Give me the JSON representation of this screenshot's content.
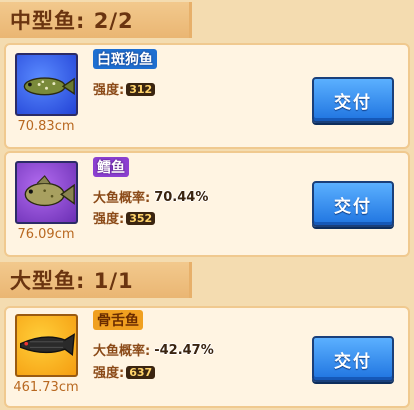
{
  "sections": [
    {
      "title": "中型鱼: 2/2"
    },
    {
      "title": "大型鱼: 1/1"
    }
  ],
  "cards": [
    {
      "name": "白斑狗鱼",
      "size": "70.83cm",
      "strength_label": "强度:",
      "strength": "312",
      "button": "交付",
      "rarity_color": "#1f6fd0"
    },
    {
      "name": "鳕鱼",
      "size": "76.09cm",
      "bigfish_label": "大鱼概率:",
      "bigfish": "70.44%",
      "strength_label": "强度:",
      "strength": "352",
      "button": "交付",
      "rarity_color": "#8b3fd0"
    },
    {
      "name": "骨舌鱼",
      "size": "461.73cm",
      "bigfish_label": "大鱼概率:",
      "bigfish": "-42.47%",
      "strength_label": "强度:",
      "strength": "637",
      "button": "交付",
      "rarity_color": "#f0a020"
    }
  ]
}
